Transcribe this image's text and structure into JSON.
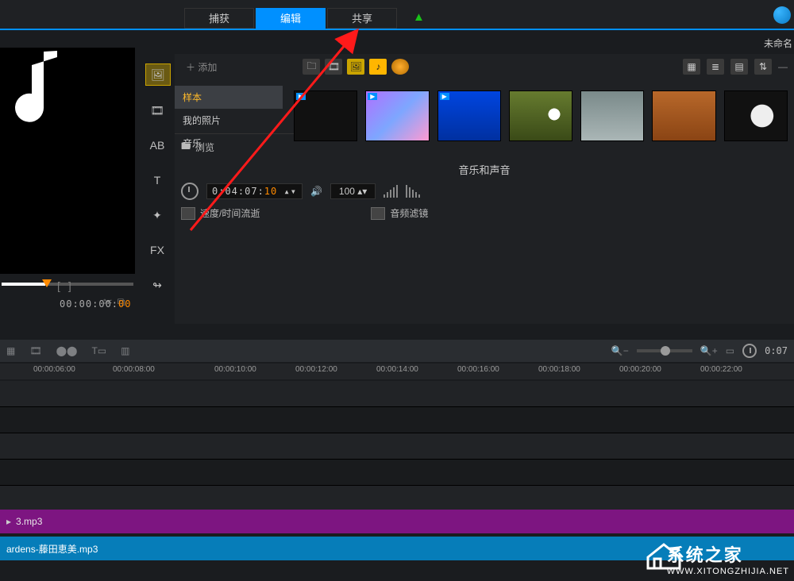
{
  "header": {
    "tab_capture": "捕获",
    "tab_edit": "编辑",
    "tab_share": "共享",
    "doc_title": "未命名"
  },
  "preview": {
    "timecode": "00:00:00",
    "timecode_frames": "00"
  },
  "toolstrip": {
    "media": "media",
    "transition": "transition",
    "title_tool": "AB",
    "text_tool": "T",
    "graphic": "graphic",
    "fx": "FX",
    "path": "path"
  },
  "library": {
    "add_label": "添加",
    "sidebar": {
      "sample": "样本",
      "my_photos": "我的照片",
      "music": "音乐"
    },
    "browse": "浏览",
    "section_title": "音乐和声音",
    "timecode": "0:04:07:",
    "timecode_frames": "10",
    "volume": "100",
    "speed_label": "速度/时间流逝",
    "audio_filter_label": "音频滤镜"
  },
  "timeline": {
    "zoom_timecode": "0:07",
    "ticks": [
      "00:00:06:00",
      "00:00:08:00",
      "00:00:10:00",
      "00:00:12:00",
      "00:00:14:00",
      "00:00:16:00",
      "00:00:18:00",
      "00:00:20:00",
      "00:00:22:00"
    ]
  },
  "tracks": {
    "clip1": "3.mp3",
    "clip2": "ardens-藤田恵美.mp3"
  },
  "watermark": {
    "cn": "系统之家",
    "en": "WWW.XITONGZHIJIA.NET"
  }
}
